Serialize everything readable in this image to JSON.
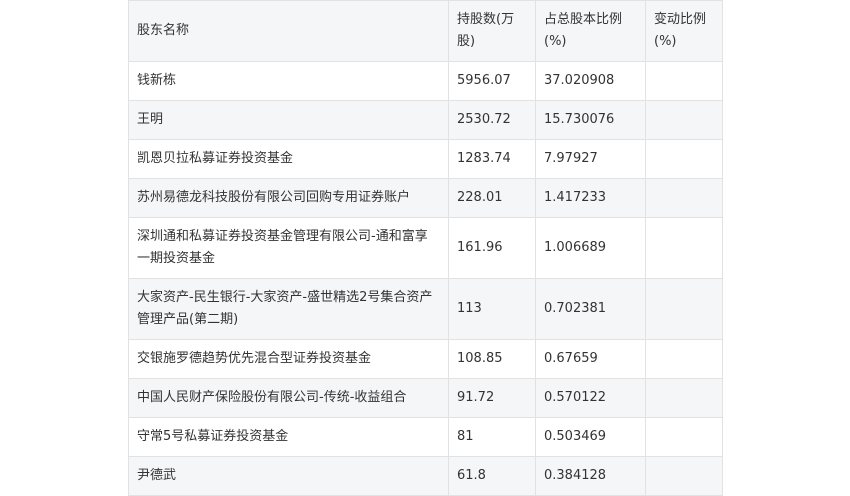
{
  "headers": [
    "股东名称",
    "持股数(万股)",
    "占总股本比例(%)",
    "变动比例(%)"
  ],
  "rows": [
    {
      "name": "钱新栋",
      "shares": "5956.07",
      "ratio": "37.020908",
      "change": ""
    },
    {
      "name": "王明",
      "shares": "2530.72",
      "ratio": "15.730076",
      "change": ""
    },
    {
      "name": "凯恩贝拉私募证券投资基金",
      "shares": "1283.74",
      "ratio": "7.97927",
      "change": ""
    },
    {
      "name": "苏州易德龙科技股份有限公司回购专用证券账户",
      "shares": "228.01",
      "ratio": "1.417233",
      "change": ""
    },
    {
      "name": "深圳通和私募证券投资基金管理有限公司-通和富享一期投资基金",
      "shares": "161.96",
      "ratio": "1.006689",
      "change": ""
    },
    {
      "name": "大家资产-民生银行-大家资产-盛世精选2号集合资产管理产品(第二期)",
      "shares": "113",
      "ratio": "0.702381",
      "change": ""
    },
    {
      "name": "交银施罗德趋势优先混合型证券投资基金",
      "shares": "108.85",
      "ratio": "0.67659",
      "change": ""
    },
    {
      "name": "中国人民财产保险股份有限公司-传统-收益组合",
      "shares": "91.72",
      "ratio": "0.570122",
      "change": ""
    },
    {
      "name": "守常5号私募证券投资基金",
      "shares": "81",
      "ratio": "0.503469",
      "change": ""
    },
    {
      "name": "尹德武",
      "shares": "61.8",
      "ratio": "0.384128",
      "change": ""
    }
  ]
}
